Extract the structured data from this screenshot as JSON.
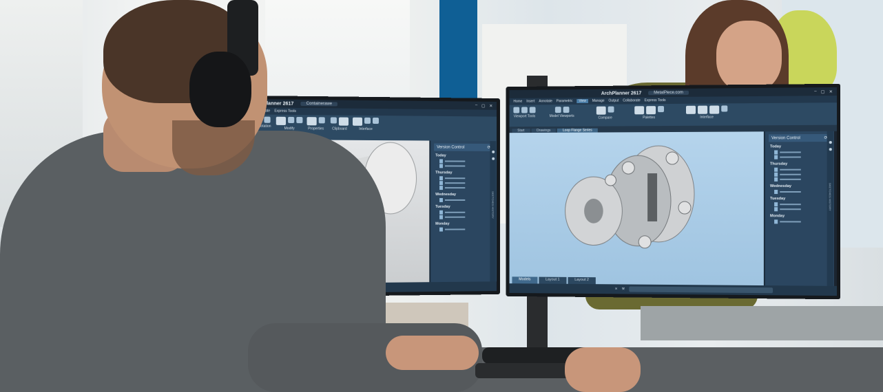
{
  "scene": {
    "colors": {
      "screen_ui": "#2d4a63",
      "pillar": "#0f5f95",
      "viewport_left": "#d7dadd",
      "viewport_right": "#a9cbe6"
    }
  },
  "monitor_left": {
    "app_title": "ArchPlanner 2617",
    "document_tab": "Containerawe",
    "menu": [
      "Collaborate",
      "Express Tools"
    ],
    "ribbon_groups": [
      "Annotation",
      "Modify",
      "Properties",
      "Clipboard",
      "Interface"
    ],
    "panel_title": "Version Control",
    "panel_days": [
      "Today",
      "Thursday",
      "Wednesday",
      "Tuesday",
      "Monday"
    ],
    "panel_side_text": "SKETCHES HISTORY"
  },
  "monitor_right": {
    "app_title": "ArchPlanner 2617",
    "document_tab": "MetalPiece.com",
    "menu": [
      "Home",
      "Insert",
      "Annotate",
      "Parametric",
      "View",
      "Manage",
      "Output",
      "Collaborate",
      "Express Tools"
    ],
    "active_menu": "View",
    "ribbon_groups": [
      "Viewport Tools",
      "Model Viewports",
      "Compare",
      "Palettes",
      "Interface"
    ],
    "doc_tabs": [
      "Start",
      "Drawings",
      "Loop Flange Series"
    ],
    "panel_title": "Version Control",
    "panel_days": [
      "Today",
      "Thursday",
      "Wednesday",
      "Tuesday",
      "Monday"
    ],
    "panel_side_text": "SKETCHES HISTORY",
    "layout_tabs": [
      "Models",
      "Layout 1",
      "Layout 2"
    ]
  }
}
